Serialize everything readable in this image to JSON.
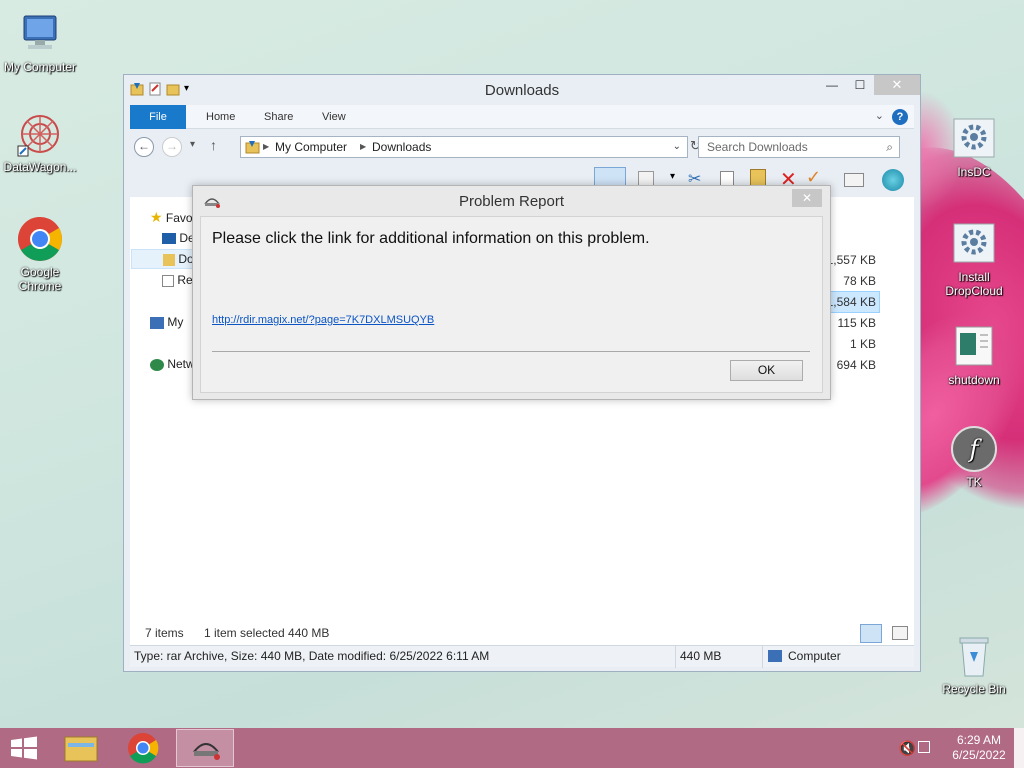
{
  "desktop": {
    "icons_left": [
      {
        "label": "My Computer"
      },
      {
        "label": "DataWagon..."
      },
      {
        "label": "Google Chrome"
      }
    ],
    "icons_right": [
      {
        "label": "InsDC"
      },
      {
        "label": "Install DropCloud"
      },
      {
        "label": "shutdown"
      },
      {
        "label": "TK"
      },
      {
        "label": "Recycle Bin"
      }
    ]
  },
  "explorer": {
    "title": "Downloads",
    "ribbon": {
      "file": "File",
      "home": "Home",
      "share": "Share",
      "view": "View"
    },
    "address": {
      "root": "My Computer",
      "current": "Downloads"
    },
    "search_placeholder": "Search Downloads",
    "nav": {
      "favorites": "Favo",
      "desktop": "De",
      "downloads": "Do",
      "recent": "Re",
      "mycomputer": "My",
      "network": "Netw"
    },
    "sizes": [
      "1,557 KB",
      "78 KB",
      "1,584 KB",
      "115 KB",
      "1 KB",
      "694 KB"
    ],
    "status": {
      "items": "7 items",
      "selected": "1 item selected  440 MB"
    },
    "details": {
      "info": "Type: rar Archive, Size: 440 MB, Date modified: 6/25/2022 6:11 AM",
      "size": "440 MB",
      "location": "Computer"
    }
  },
  "dialog": {
    "title": "Problem Report",
    "message": "Please click the link for additional information on this problem.",
    "link": "http://rdir.magix.net/?page=7K7DXLMSUQYB",
    "ok": "OK"
  },
  "taskbar": {
    "time": "6:29 AM",
    "date": "6/25/2022"
  },
  "colors": {
    "accent": "#1979ca",
    "taskbar": "#b06a84",
    "link": "#0b55c4"
  }
}
